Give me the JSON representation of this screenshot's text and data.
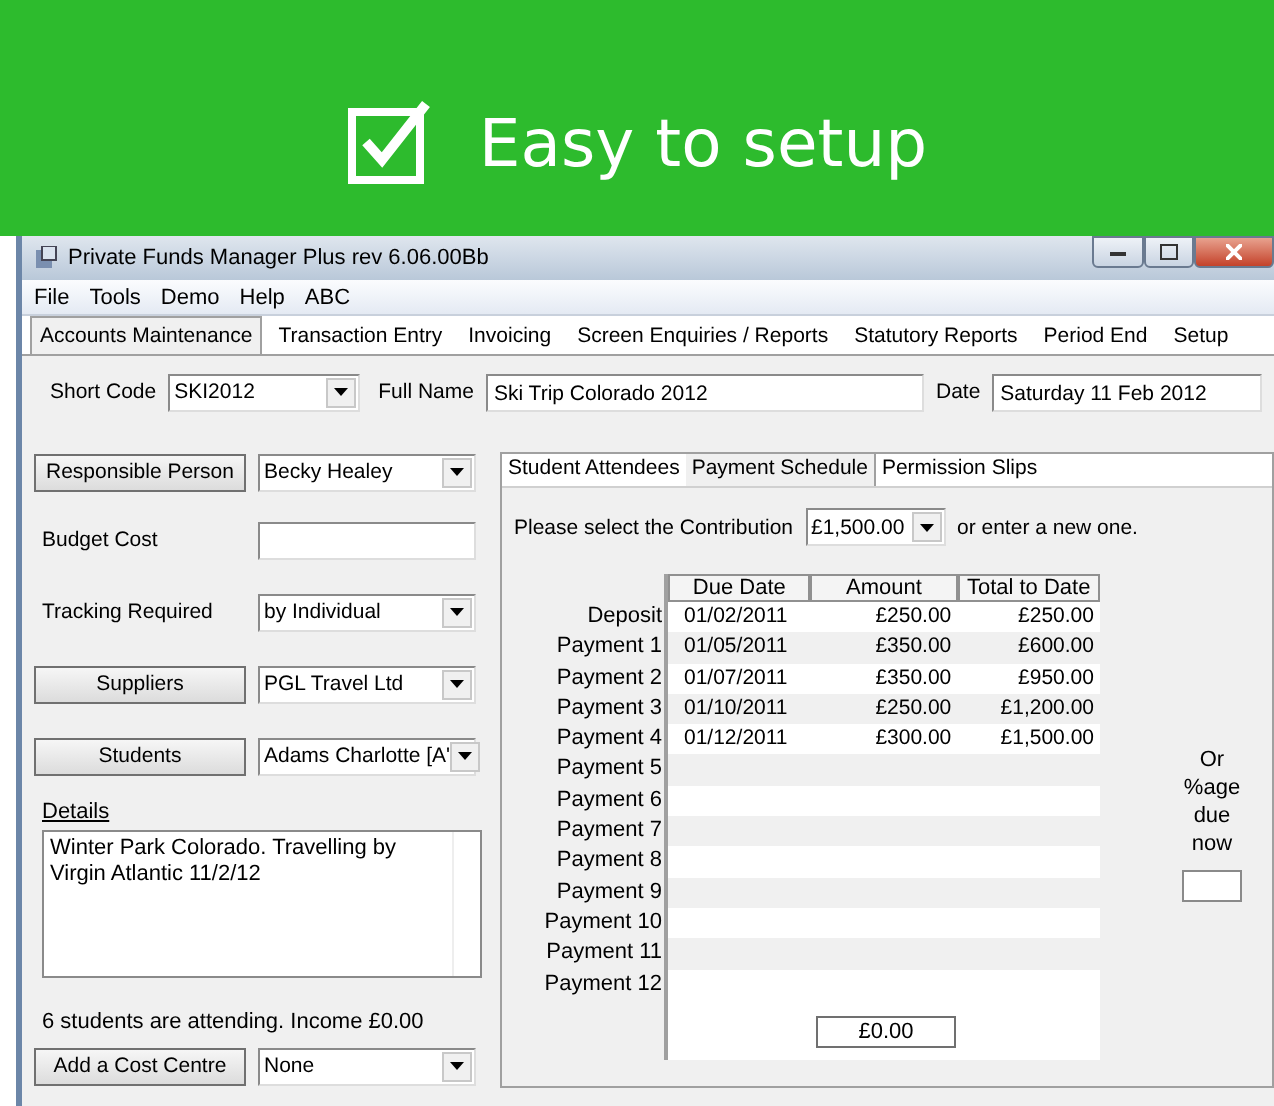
{
  "banner": {
    "title": "Easy to setup"
  },
  "window": {
    "title": "Private Funds Manager Plus rev 6.06.00Bb"
  },
  "menu": [
    "File",
    "Tools",
    "Demo",
    "Help",
    "ABC"
  ],
  "tabs": [
    {
      "label": "Accounts Maintenance",
      "selected": true
    },
    {
      "label": "Transaction Entry",
      "selected": false
    },
    {
      "label": "Invoicing",
      "selected": false
    },
    {
      "label": "Screen Enquiries / Reports",
      "selected": false
    },
    {
      "label": "Statutory Reports",
      "selected": false
    },
    {
      "label": "Period End",
      "selected": false
    },
    {
      "label": "Setup",
      "selected": false
    }
  ],
  "header": {
    "short_code": {
      "label": "Short Code",
      "value": "SKI2012"
    },
    "full_name": {
      "label": "Full Name",
      "value": "Ski Trip Colorado 2012"
    },
    "date": {
      "label": "Date",
      "value": "Saturday 11 Feb 2012"
    }
  },
  "left_rows": [
    {
      "kind": "button-select",
      "label": "Responsible Person",
      "value": "Becky Healey"
    },
    {
      "kind": "label-input",
      "label": "Budget Cost"
    },
    {
      "kind": "label-select",
      "label": "Tracking Required",
      "value": "by Individual"
    },
    {
      "kind": "button-select",
      "label": "Suppliers",
      "value": "PGL Travel Ltd"
    },
    {
      "kind": "button-select",
      "label": "Students",
      "value": "Adams Charlotte [A'"
    }
  ],
  "details": {
    "label": "Details",
    "value": "Winter Park Colorado. Travelling by Virgin Atlantic 11/2/12"
  },
  "summary": "6 students are attending. Income £0.00",
  "cost_centre": {
    "label": "Add a Cost Centre",
    "value": "None"
  },
  "subtabs": [
    {
      "label": "Student Attendees",
      "selected": false
    },
    {
      "label": "Payment Schedule",
      "selected": true
    },
    {
      "label": "Permission Slips",
      "selected": false
    }
  ],
  "contribution": {
    "label": "Please select the Contribution",
    "value": "£1,500.00",
    "suffix": "or enter a new one."
  },
  "schedule": {
    "columns": [
      "Due Date",
      "Amount",
      "Total to Date"
    ],
    "rows": [
      {
        "label": "Deposit",
        "due_date": "01/02/2011",
        "amount": "£250.00",
        "total": "£250.00"
      },
      {
        "label": "Payment 1",
        "due_date": "01/05/2011",
        "amount": "£350.00",
        "total": "£600.00"
      },
      {
        "label": "Payment 2",
        "due_date": "01/07/2011",
        "amount": "£350.00",
        "total": "£950.00"
      },
      {
        "label": "Payment 3",
        "due_date": "01/10/2011",
        "amount": "£250.00",
        "total": "£1,200.00"
      },
      {
        "label": "Payment 4",
        "due_date": "01/12/2011",
        "amount": "£300.00",
        "total": "£1,500.00"
      },
      {
        "label": "Payment 5"
      },
      {
        "label": "Payment 6"
      },
      {
        "label": "Payment 7"
      },
      {
        "label": "Payment 8"
      },
      {
        "label": "Payment 9"
      },
      {
        "label": "Payment 10"
      },
      {
        "label": "Payment 11"
      },
      {
        "label": "Payment 12"
      }
    ],
    "total": "£0.00"
  },
  "percent": {
    "label": "Or %age due now"
  }
}
